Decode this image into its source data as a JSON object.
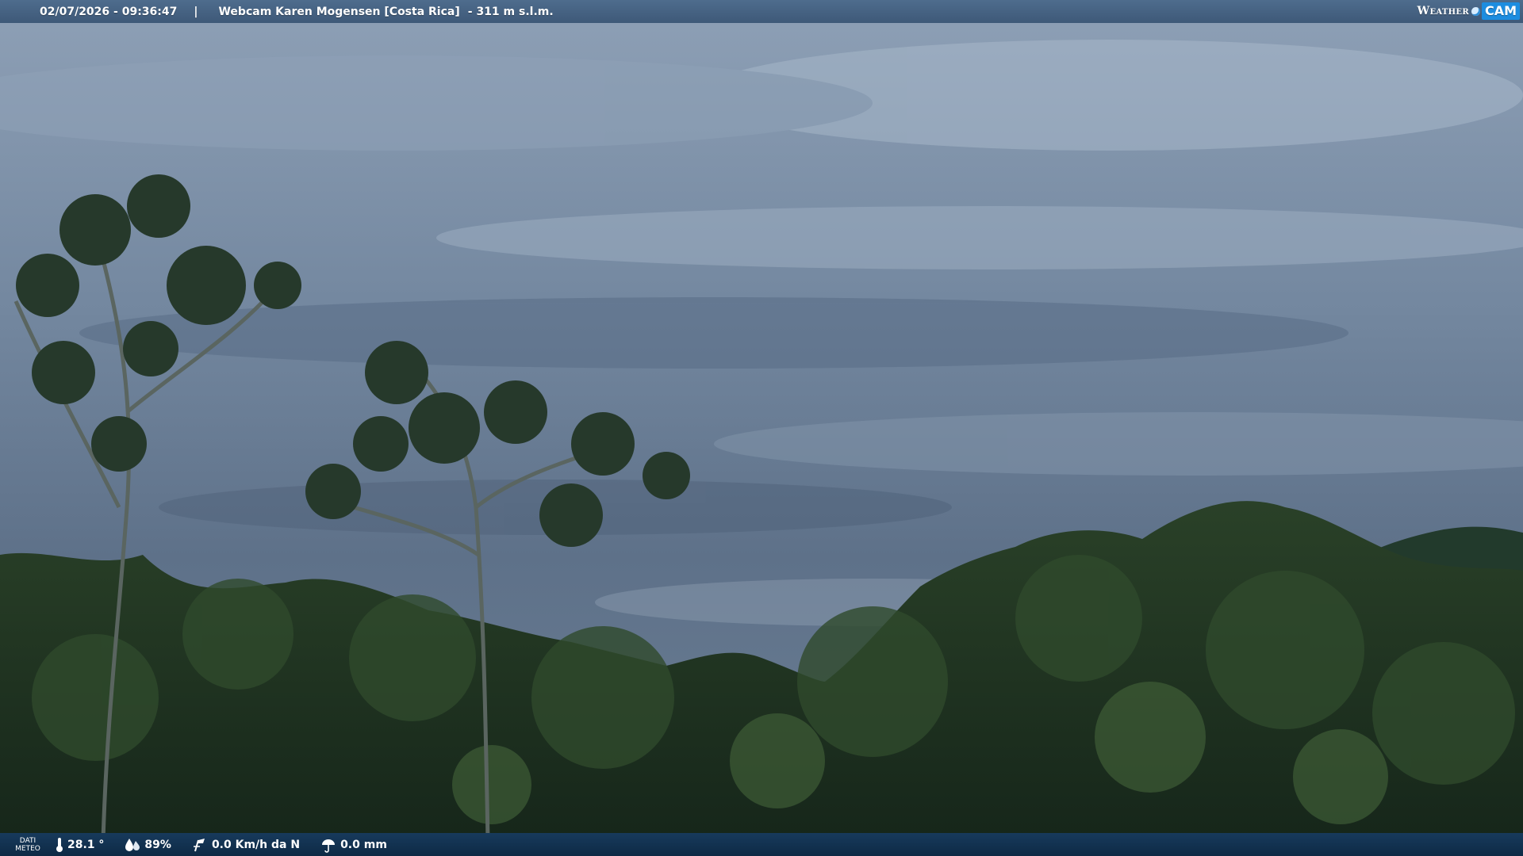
{
  "overlay": {
    "timestamp": "02/07/2026 - 09:36:47",
    "separator": "|",
    "title": "Webcam Karen Mogensen [Costa Rica]",
    "altitude": "- 311 m s.l.m.",
    "brand": {
      "prefix": "Weather",
      "suffix": "CAM"
    }
  },
  "weather": {
    "label_line1": "DATI",
    "label_line2": "METEO",
    "temperature": "28.1 °",
    "humidity": "89%",
    "wind": "0.0 Km/h da N",
    "rain": "0.0 mm"
  },
  "colors": {
    "top_bar": "#4a6788",
    "bottom_bar": "#12324f",
    "sky": "#6f8297",
    "forest": "#20341f"
  }
}
